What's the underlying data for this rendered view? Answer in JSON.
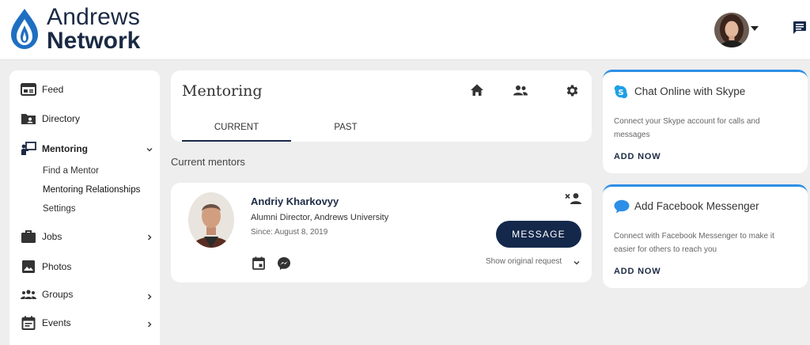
{
  "brand": {
    "line1": "Andrews",
    "line2": "Network"
  },
  "sidebar": {
    "items": [
      {
        "label": "Feed",
        "icon": "feed-icon"
      },
      {
        "label": "Directory",
        "icon": "directory-icon"
      },
      {
        "label": "Mentoring",
        "icon": "mentoring-icon"
      },
      {
        "label": "Jobs",
        "icon": "jobs-icon"
      },
      {
        "label": "Photos",
        "icon": "photos-icon"
      },
      {
        "label": "Groups",
        "icon": "groups-icon"
      },
      {
        "label": "Events",
        "icon": "events-icon"
      }
    ],
    "mentoring_sub": [
      "Find a Mentor",
      "Mentoring Relationships",
      "Settings"
    ]
  },
  "mentoring": {
    "title": "Mentoring",
    "tabs": [
      "CURRENT",
      "PAST"
    ],
    "section_label": "Current mentors"
  },
  "mentor": {
    "name": "Andriy Kharkovyy",
    "role": "Alumni Director, Andrews University",
    "since": "Since: August 8, 2019",
    "message_label": "MESSAGE",
    "show_request": "Show original request"
  },
  "cards": [
    {
      "title": "Chat Online with Skype",
      "desc": "Connect your Skype account for calls and messages",
      "action": "ADD NOW",
      "icon": "skype-icon"
    },
    {
      "title": "Add Facebook Messenger",
      "desc": "Connect with Facebook Messenger to make it easier for others to reach you",
      "action": "ADD NOW",
      "icon": "messenger-bubble-icon"
    }
  ],
  "colors": {
    "navy": "#14284b",
    "accent": "#2d8fe6",
    "logo_blue": "#1f6fc1"
  }
}
